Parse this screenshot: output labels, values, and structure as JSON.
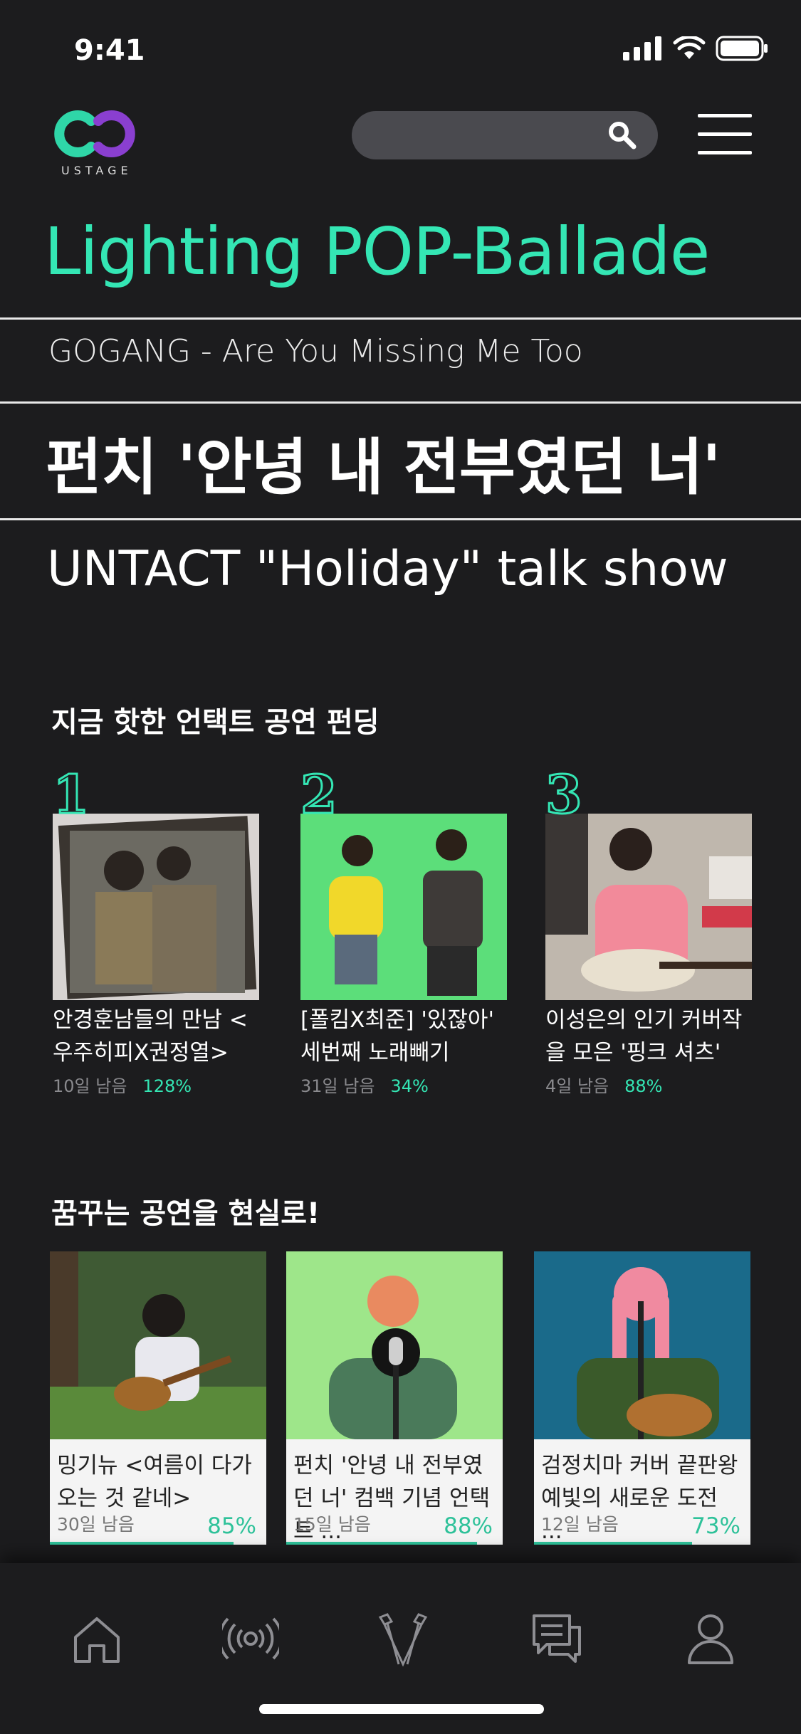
{
  "status": {
    "time": "9:41"
  },
  "header": {
    "logo_text": "USTAGE"
  },
  "hero": {
    "title": "Lighting POP-Ballade"
  },
  "rolling": [
    "GOGANG - Are You Missing Me Too",
    "펀치 '안녕 내 전부였던 너'",
    "UNTACT \"Holiday\" talk show"
  ],
  "trending": {
    "title": "지금 핫한 언택트 공연 펀딩",
    "items": [
      {
        "rank": "1",
        "title": "안경훈남들의 만남 <우주히피X권정열>",
        "days": "10일 남음",
        "percent": "128%",
        "image": "band-photo"
      },
      {
        "rank": "2",
        "title": "[폴킴X최준] '있잖아' 세번째 노래빼기",
        "days": "31일 남음",
        "percent": "34%",
        "image": "duo-singing-photo"
      },
      {
        "rank": "3",
        "title": "이성은의 인기 커버작을 모은 '핑크 셔츠'",
        "days": "4일 남음",
        "percent": "88%",
        "image": "guitar-player-photo"
      }
    ]
  },
  "dream": {
    "title": "꿈꾸는 공연을 현실로!",
    "items": [
      {
        "title": "밍기뉴 <여름이 다가오는 것 같네>",
        "days": "30일 남음",
        "percent": "85%",
        "progress": 0.85,
        "image": "ukulele-in-grass-photo"
      },
      {
        "title": "펀치 '안녕 내 전부였던 너' 컴백 기념 언택트 ...",
        "days": "15일 남음",
        "percent": "88%",
        "progress": 0.88,
        "image": "singer-green-screen-photo"
      },
      {
        "title": "검정치마 커버 끝판왕 예빛의 새로운 도전 ...",
        "days": "12일 남음",
        "percent": "73%",
        "progress": 0.73,
        "image": "singer-guitar-stage-photo"
      }
    ]
  },
  "tabs": [
    {
      "name": "home",
      "icon": "home-icon"
    },
    {
      "name": "live",
      "icon": "broadcast-icon"
    },
    {
      "name": "stage",
      "icon": "spotlight-icon"
    },
    {
      "name": "chat",
      "icon": "chat-icon"
    },
    {
      "name": "profile",
      "icon": "profile-icon"
    }
  ],
  "colors": {
    "accent": "#34e6b4",
    "background": "#1c1c1e",
    "logo_teal": "#2fd6a8",
    "logo_purple": "#8a3fd0"
  }
}
